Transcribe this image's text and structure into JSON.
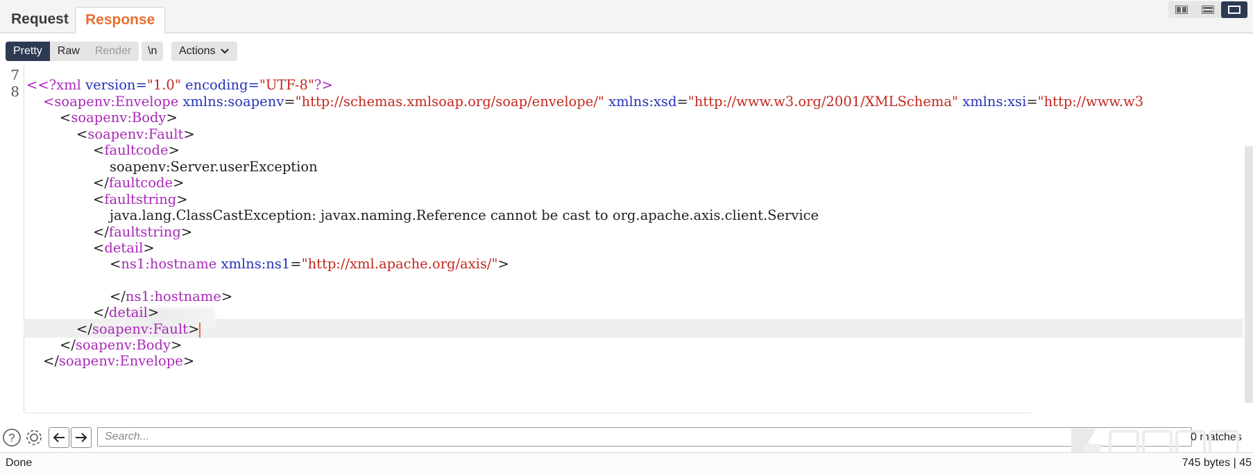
{
  "tabs": [
    {
      "label": "Request",
      "active": false
    },
    {
      "label": "Response",
      "active": true
    }
  ],
  "view_buttons": [
    {
      "icon": "split-horizontal-icon",
      "active": false
    },
    {
      "icon": "split-vertical-icon",
      "active": false
    },
    {
      "icon": "single-pane-icon",
      "active": true
    }
  ],
  "toolbar": {
    "pretty": "Pretty",
    "raw": "Raw",
    "render": "Render",
    "newline": "\\n",
    "actions": "Actions",
    "actions_icon": "chevron-down-icon"
  },
  "editor": {
    "line_numbers": [
      "7",
      "8"
    ],
    "lines": {
      "l1_decl": "<?xml",
      "l1_attr1": " version=",
      "l1_val1": "\"1.0\"",
      "l1_attr2": " encoding=",
      "l1_val2": "\"UTF-8\"",
      "l1_end": "?>",
      "l2_open": "<",
      "l2_tag": "soapenv:Envelope",
      "l2_attr1": " xmlns:soapenv",
      "l2_eq1": "=",
      "l2_val1": "\"http://schemas.xmlsoap.org/soap/envelope/\"",
      "l2_attr2": " xmlns:xsd",
      "l2_eq2": "=",
      "l2_val2": "\"http://www.w3.org/2001/XMLSchema\"",
      "l2_attr3": " xmlns:xsi",
      "l2_eq3": "=",
      "l2_val3": "\"http://www.w3",
      "l3_tag": "soapenv:Body",
      "l4_tag": "soapenv:Fault",
      "l5_tag": "faultcode",
      "l6_text": "soapenv:Server.userException",
      "l7_tag": "faultcode",
      "l8_tag": "faultstring",
      "l9_text": "java.lang.ClassCastException: javax.naming.Reference cannot be cast to org.apache.axis.client.Service",
      "l10_tag": "faultstring",
      "l11_tag": "detail",
      "l12_tag": "ns1:hostname",
      "l12_attr": " xmlns:ns1",
      "l12_eq": "=",
      "l12_val": "\"http://xml.apache.org/axis/\"",
      "l14_tag": "ns1:hostname",
      "l15_tag": "detail",
      "l16_tag": "soapenv:Fault",
      "l17_tag": "soapenv:Body",
      "l18_tag": "soapenv:Envelope"
    }
  },
  "search": {
    "placeholder": "Search...",
    "value": "",
    "matches": "0 matches"
  },
  "status": {
    "left": "Done",
    "right": "745 bytes | 45"
  },
  "colors": {
    "accent": "#e8702e",
    "active_dark": "#2e3a52",
    "xml_tag": "#a829b8",
    "xml_attr": "#2632b8",
    "xml_value": "#c2281f"
  },
  "watermark": "先知社区"
}
